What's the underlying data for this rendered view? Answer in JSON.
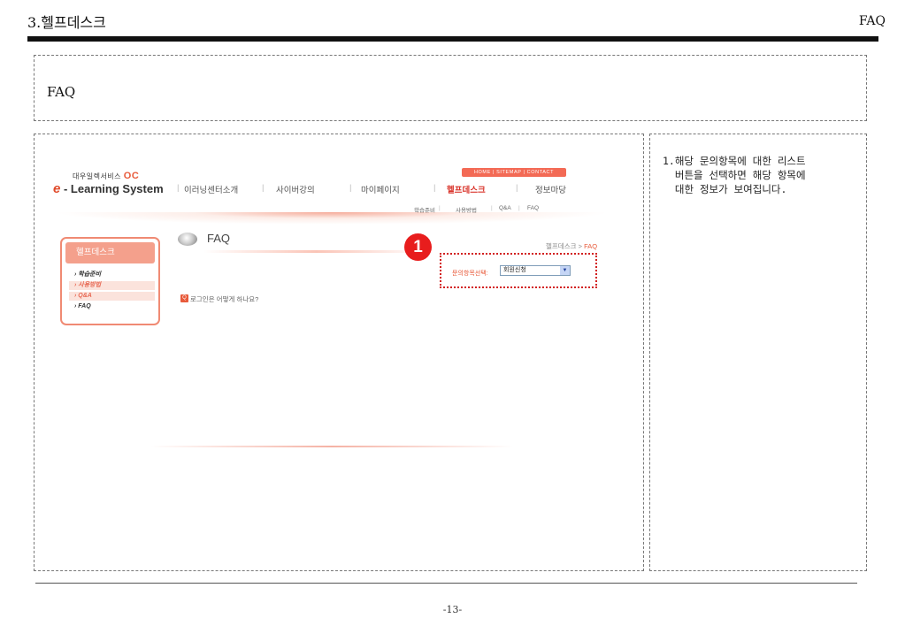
{
  "header": {
    "title": "3.헬프데스크",
    "section": "FAQ"
  },
  "top_box": {
    "label": "FAQ"
  },
  "site": {
    "brand_small": "대우일렉서비스",
    "brand_mark": "OC",
    "brand_e": "e",
    "brand_name": " - Learning System",
    "nav": [
      "이러닝센터소개",
      "사이버강의",
      "마이페이지",
      "헬프데스크",
      "정보마당"
    ],
    "util_links": "HOME | SITEMAP | CONTACT",
    "subnav": [
      "학습준비",
      "사용방법",
      "Q&A",
      "FAQ"
    ],
    "left_menu": {
      "title": "헬프데스크",
      "items": [
        "학습준비",
        "사용방법",
        "Q&A",
        "FAQ"
      ]
    },
    "page_title": "FAQ",
    "breadcrumb_base": "헬프데스크 > ",
    "breadcrumb_current": "FAQ",
    "badge": "1",
    "select_label": "문의항목선택:",
    "select_value": "회원신청",
    "question_icon": "Q",
    "question": "로그인은 어떻게 하나요?"
  },
  "side_note": "1.해당 문의항목에 대한 리스트\n  버튼을 선택하면 해당 항목에\n  대한 정보가 보여집니다.",
  "footer": {
    "page": "-13-"
  },
  "colors": {
    "accent": "#e85a3a",
    "badge": "#e81d1d",
    "panel_pink": "#f4a08c"
  }
}
